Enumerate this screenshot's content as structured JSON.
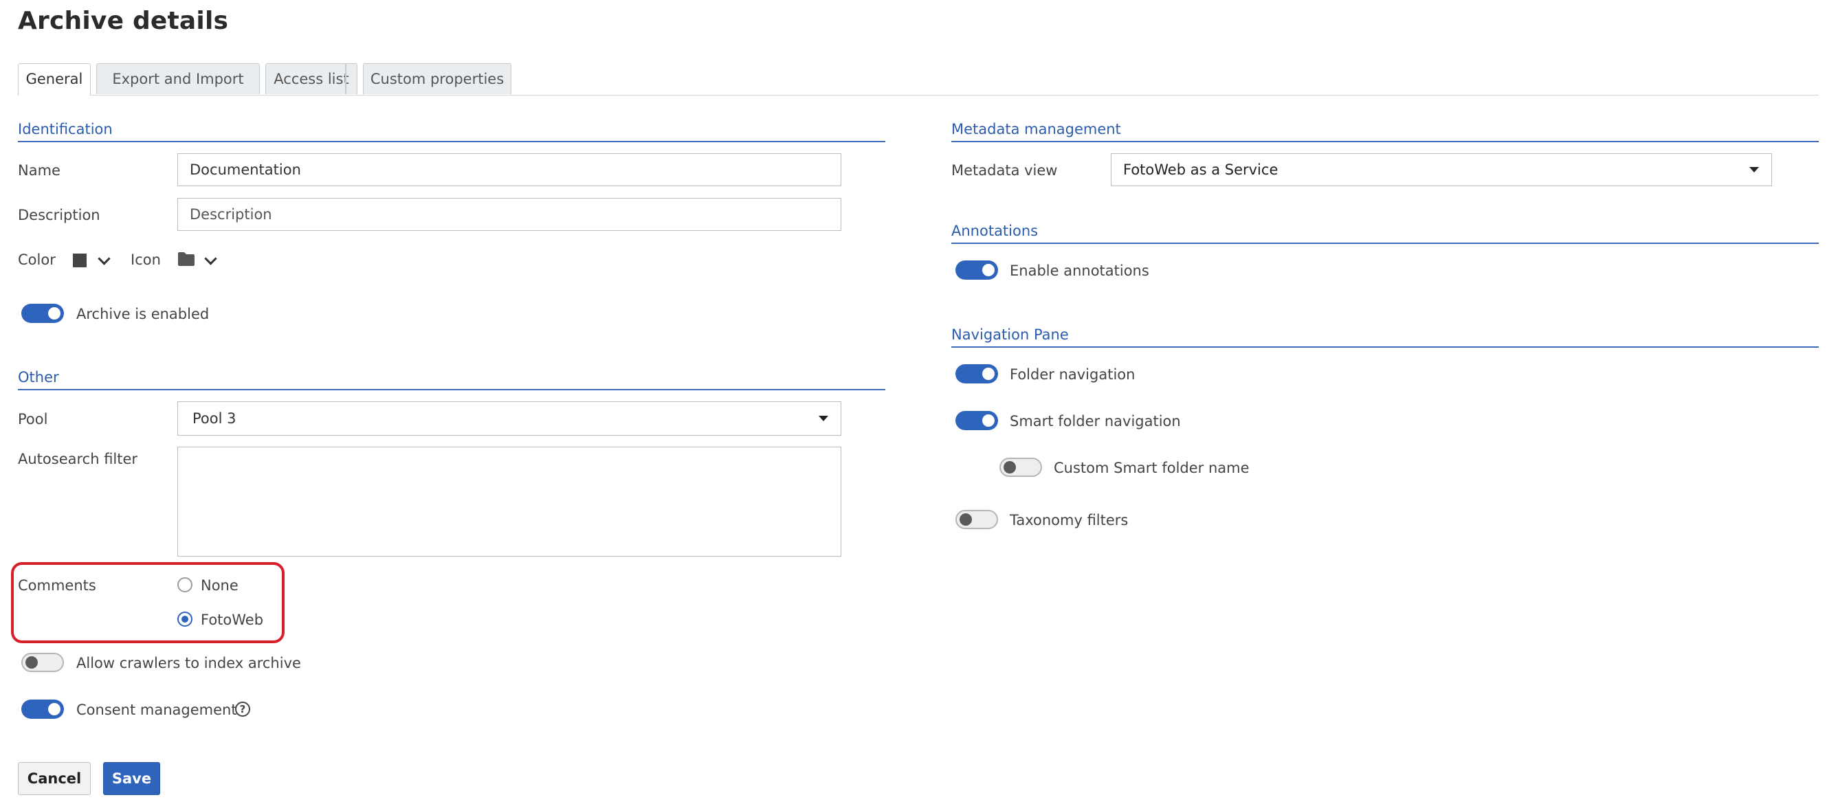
{
  "page": {
    "title": "Archive details"
  },
  "tabs": [
    {
      "label": "General",
      "active": true
    },
    {
      "label": "Export and Import",
      "active": false
    },
    {
      "label": "Access list",
      "active": false
    },
    {
      "label": "Custom properties",
      "active": false
    }
  ],
  "identification": {
    "section_title": "Identification",
    "name_label": "Name",
    "name_value": "Documentation",
    "description_label": "Description",
    "description_placeholder": "Description",
    "color_label": "Color",
    "color_value": "#444444",
    "icon_label": "Icon",
    "icon_name": "folder-icon",
    "archive_enabled_label": "Archive is enabled",
    "archive_enabled": true
  },
  "other": {
    "section_title": "Other",
    "pool_label": "Pool",
    "pool_value": "Pool 3",
    "autosearch_label": "Autosearch filter",
    "autosearch_value": "",
    "comments_label": "Comments",
    "comments_options": [
      {
        "label": "None",
        "checked": false
      },
      {
        "label": "FotoWeb",
        "checked": true
      }
    ],
    "crawlers_label": "Allow crawlers to index archive",
    "crawlers_enabled": false,
    "consent_label": "Consent management",
    "consent_enabled": true,
    "consent_help": "?"
  },
  "metadata": {
    "section_title": "Metadata management",
    "view_label": "Metadata view",
    "view_value": "FotoWeb as a Service"
  },
  "annotations": {
    "section_title": "Annotations",
    "enable_label": "Enable annotations",
    "enabled": true
  },
  "navigation": {
    "section_title": "Navigation Pane",
    "folder_label": "Folder navigation",
    "folder_enabled": true,
    "smart_label": "Smart folder navigation",
    "smart_enabled": true,
    "custom_smart_label": "Custom Smart folder name",
    "custom_smart_enabled": false,
    "taxonomy_label": "Taxonomy filters",
    "taxonomy_enabled": false
  },
  "actions": {
    "cancel_label": "Cancel",
    "save_label": "Save"
  },
  "colors": {
    "accent": "#2f64bd",
    "highlight": "#d8202a"
  }
}
